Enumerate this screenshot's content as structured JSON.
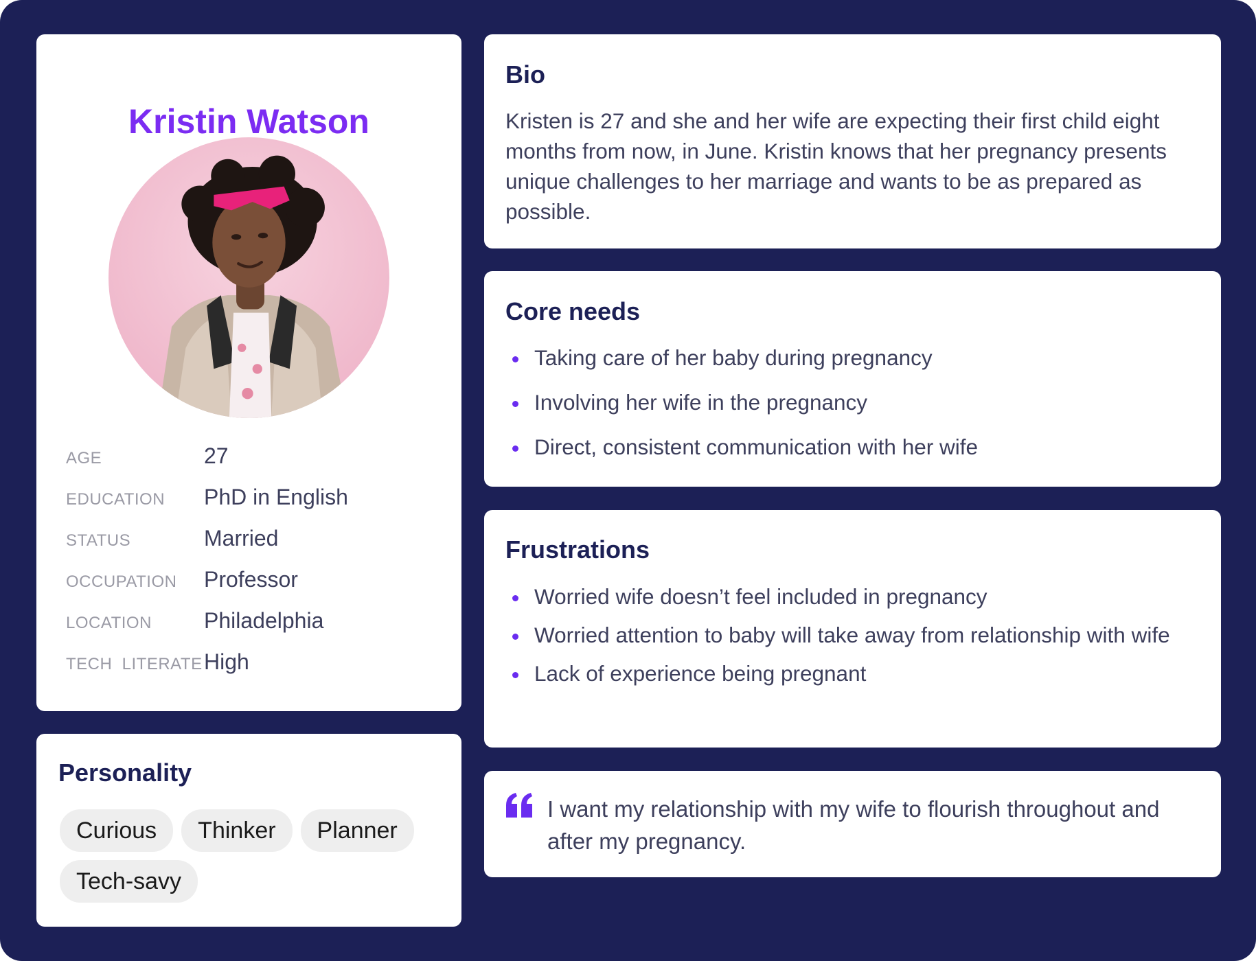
{
  "profile": {
    "name": "Kristin Watson",
    "avatar_icon": "portrait-photo",
    "facts": [
      {
        "label": "AGE",
        "value": "27"
      },
      {
        "label": "EDUCATION",
        "value": "PhD in English"
      },
      {
        "label": "STATUS",
        "value": "Married"
      },
      {
        "label": "OCCUPATION",
        "value": "Professor"
      },
      {
        "label": "LOCATION",
        "value": "Philadelphia"
      },
      {
        "label": "TECH  LITERATE",
        "value": "High"
      }
    ]
  },
  "personality": {
    "title": "Personality",
    "traits": [
      "Curious",
      "Thinker",
      "Planner",
      "Tech-savy"
    ]
  },
  "bio": {
    "title": "Bio",
    "text": "Kristen is 27 and she and her wife are expecting their first child eight months from now, in June. Kristin knows that her pregnancy presents unique challenges to her marriage and wants to be as prepared as possible."
  },
  "core_needs": {
    "title": "Core needs",
    "items": [
      "Taking care of her baby during pregnancy",
      "Involving her wife in the pregnancy",
      "Direct, consistent communication with her wife"
    ]
  },
  "frustrations": {
    "title": "Frustrations",
    "items": [
      "Worried wife doesn’t feel included in pregnancy",
      "Worried attention to baby will take away from relationship with wife",
      "Lack of experience being pregnant"
    ]
  },
  "quote": {
    "icon": "quote-icon",
    "text": "I want my relationship with my wife to flourish throughout and after my pregnancy."
  },
  "colors": {
    "background": "#1c2056",
    "accent": "#7b2cf2",
    "text": "#3d3f5c",
    "chip": "#eeeeee"
  }
}
